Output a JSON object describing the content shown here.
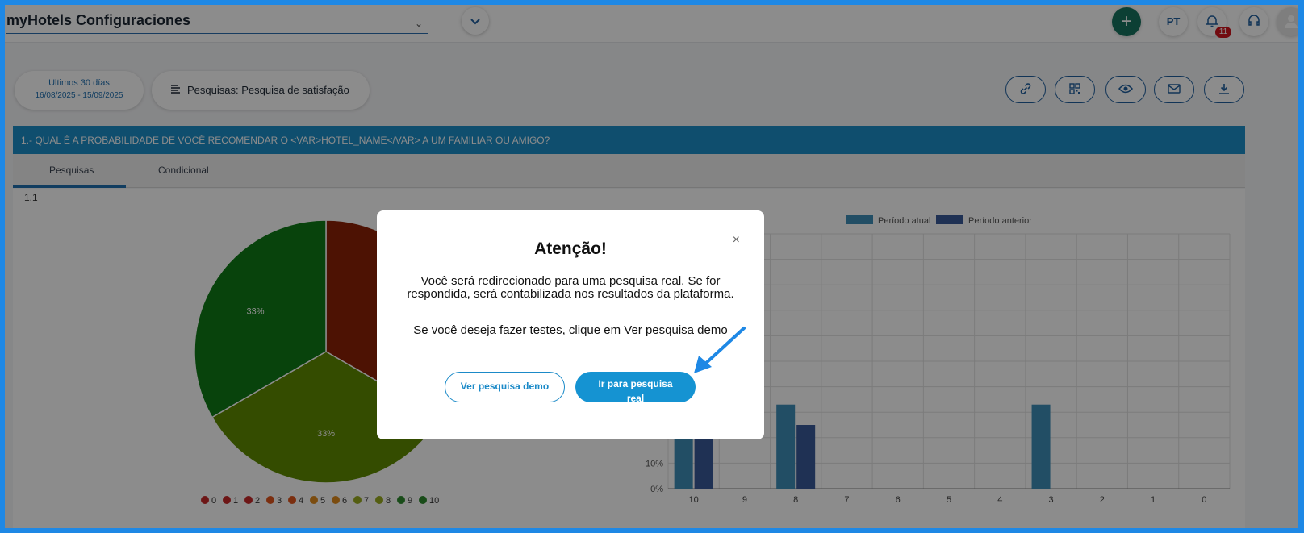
{
  "header": {
    "app_title": "myHotels Configuraciones",
    "lang": "PT",
    "notifications_count": "11",
    "icons": [
      "plus-icon",
      "bell-icon",
      "headset-icon",
      "user-icon",
      "chevron-down-icon"
    ]
  },
  "filters": {
    "date_label": "Ultimos 30 días",
    "date_range": "16/08/2025 - 15/09/2025",
    "survey_label": "Pesquisas: Pesquisa de satisfação",
    "actions": [
      "link-icon",
      "qr-icon",
      "eye-icon",
      "mail-icon",
      "download-icon"
    ]
  },
  "question": {
    "title": "1.- QUAL É A PROBABILIDADE DE VOCÊ RECOMENDAR O <VAR>HOTEL_NAME</VAR> A UM FAMILIAR OU AMIGO?",
    "tabs": [
      "Pesquisas",
      "Condicional"
    ],
    "sub_label": "1.1"
  },
  "colors": {
    "accent": "#1c8ec9",
    "brand_dark": "#1f5f9e",
    "add_button": "#16745f",
    "badge": "#d0141e",
    "pie_green": "#0f7a16",
    "pie_olive": "#5f8a00",
    "pie_red": "#8c2206",
    "bar_current": "#3f8fb8",
    "bar_previous": "#3a5a9a"
  },
  "chart_data": [
    {
      "type": "pie",
      "slices": [
        {
          "label": "33%",
          "value": 33,
          "color": "#8c2206"
        },
        {
          "label": "33%",
          "value": 33,
          "color": "#5f8a00"
        },
        {
          "label": "33%",
          "value": 33,
          "color": "#0f7a16"
        }
      ],
      "legend": [
        {
          "label": "0",
          "color": "#c62828"
        },
        {
          "label": "1",
          "color": "#c62828"
        },
        {
          "label": "2",
          "color": "#c62828"
        },
        {
          "label": "3",
          "color": "#e0541d"
        },
        {
          "label": "4",
          "color": "#e0541d"
        },
        {
          "label": "5",
          "color": "#e08a1d"
        },
        {
          "label": "6",
          "color": "#e08a1d"
        },
        {
          "label": "7",
          "color": "#9aab1f"
        },
        {
          "label": "8",
          "color": "#9aab1f"
        },
        {
          "label": "9",
          "color": "#2e8b2e"
        },
        {
          "label": "10",
          "color": "#2e8b2e"
        }
      ],
      "legend_placement": "bottom"
    },
    {
      "type": "bar",
      "categories": [
        "10",
        "9",
        "8",
        "7",
        "6",
        "5",
        "4",
        "3",
        "2",
        "1",
        "0"
      ],
      "series": [
        {
          "name": "Período atual",
          "values": [
            33,
            0,
            33,
            0,
            0,
            0,
            0,
            33,
            0,
            0,
            0
          ],
          "color": "#3f8fb8"
        },
        {
          "name": "Período anterior",
          "values": [
            25,
            0,
            25,
            0,
            0,
            0,
            0,
            0,
            0,
            0,
            0
          ],
          "color": "#3a5a9a"
        }
      ],
      "y_ticks_visible": [
        "10%",
        "0%"
      ],
      "ylim": [
        0,
        100
      ],
      "grid": true,
      "legend_placement": "top"
    }
  ],
  "modal": {
    "title": "Atenção!",
    "close": "×",
    "message": "Você será redirecionado para uma pesquisa real. Se for respondida, será contabilizada nos resultados da plataforma.",
    "message2": "Se você deseja fazer testes, clique em Ver pesquisa demo",
    "btn_demo": "Ver pesquisa demo",
    "btn_real": "Ir para pesquisa real"
  }
}
